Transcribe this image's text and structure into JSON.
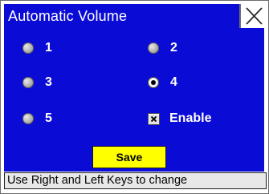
{
  "window": {
    "title": "Automatic Volume"
  },
  "options": [
    {
      "label": "1",
      "selected": false
    },
    {
      "label": "2",
      "selected": false
    },
    {
      "label": "3",
      "selected": false
    },
    {
      "label": "4",
      "selected": true
    },
    {
      "label": "5",
      "selected": false
    }
  ],
  "enable": {
    "label": "Enable",
    "checked": true
  },
  "save": {
    "label": "Save"
  },
  "status": {
    "text": "Use Right and Left Keys to change"
  },
  "colors": {
    "panel": "#0b0bd6",
    "save_button": "#ffff00",
    "status_bar": "#e8e8e8"
  },
  "icons": {
    "close": "close-icon",
    "check": "check-mark-icon"
  }
}
